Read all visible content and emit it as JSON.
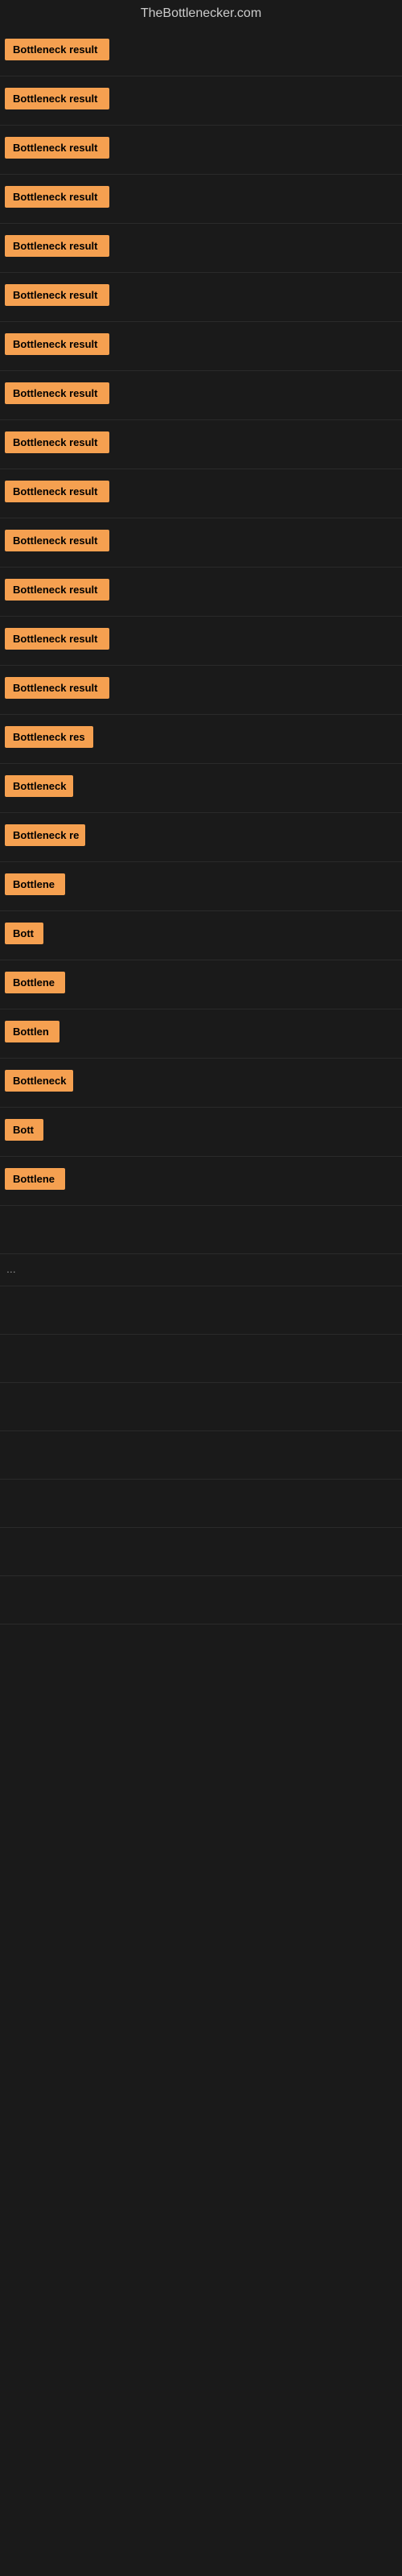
{
  "site": {
    "title": "TheBottlenecker.com"
  },
  "items": [
    {
      "label": "Bottleneck result",
      "width": 130
    },
    {
      "label": "Bottleneck result",
      "width": 130
    },
    {
      "label": "Bottleneck result",
      "width": 130
    },
    {
      "label": "Bottleneck result",
      "width": 130
    },
    {
      "label": "Bottleneck result",
      "width": 130
    },
    {
      "label": "Bottleneck result",
      "width": 130
    },
    {
      "label": "Bottleneck result",
      "width": 130
    },
    {
      "label": "Bottleneck result",
      "width": 130
    },
    {
      "label": "Bottleneck result",
      "width": 130
    },
    {
      "label": "Bottleneck result",
      "width": 130
    },
    {
      "label": "Bottleneck result",
      "width": 130
    },
    {
      "label": "Bottleneck result",
      "width": 130
    },
    {
      "label": "Bottleneck result",
      "width": 130
    },
    {
      "label": "Bottleneck result",
      "width": 130
    },
    {
      "label": "Bottleneck res",
      "width": 110
    },
    {
      "label": "Bottleneck",
      "width": 85
    },
    {
      "label": "Bottleneck re",
      "width": 100
    },
    {
      "label": "Bottlene",
      "width": 75
    },
    {
      "label": "Bott",
      "width": 48
    },
    {
      "label": "Bottlene",
      "width": 75
    },
    {
      "label": "Bottlen",
      "width": 68
    },
    {
      "label": "Bottleneck",
      "width": 85
    },
    {
      "label": "Bott",
      "width": 48
    },
    {
      "label": "Bottlene",
      "width": 75
    }
  ],
  "ellipsis": "...",
  "colors": {
    "badge_bg": "#f5a050",
    "badge_text": "#000000",
    "page_bg": "#1a1a1a",
    "title_color": "#cccccc"
  }
}
